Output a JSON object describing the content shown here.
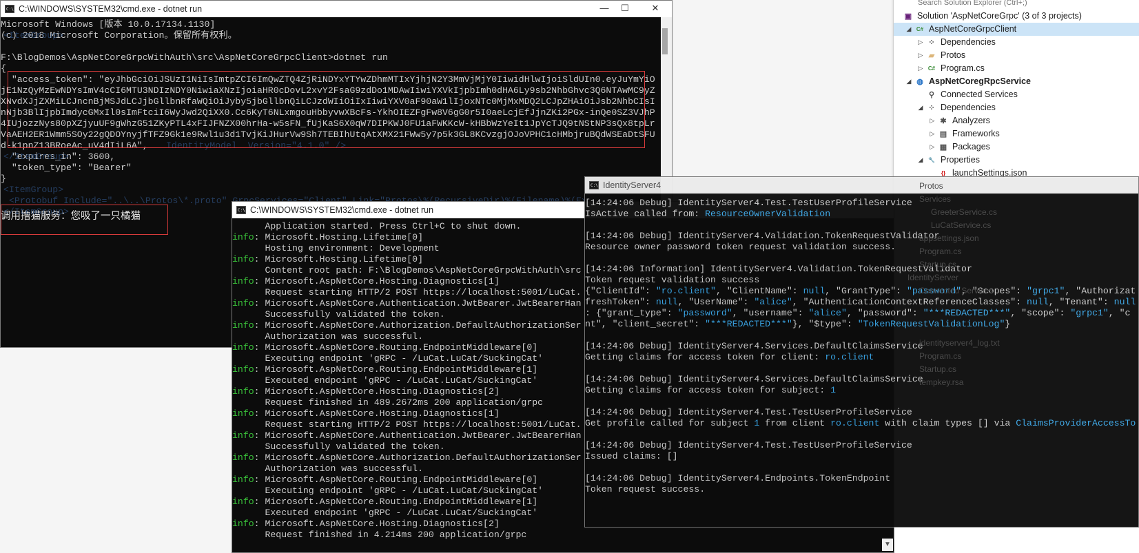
{
  "solution_explorer": {
    "search_placeholder": "Search Solution Explorer (Ctrl+;)",
    "rows": [
      {
        "label": "Solution 'AspNetCoreGrpc' (3 of 3 projects)",
        "icon": "solution-icon"
      },
      {
        "label": "AspNetCoreGrpcClient",
        "icon": "csharp-project-icon"
      },
      {
        "label": "Dependencies",
        "icon": "dependencies-icon"
      },
      {
        "label": "Protos",
        "icon": "folder-icon"
      },
      {
        "label": "Program.cs",
        "icon": "csharp-file-icon"
      },
      {
        "label": "AspNetCoregRpcService",
        "icon": "web-project-icon"
      },
      {
        "label": "Connected Services",
        "icon": "connected-services-icon"
      },
      {
        "label": "Dependencies",
        "icon": "dependencies-icon"
      },
      {
        "label": "Analyzers",
        "icon": "analyzers-icon"
      },
      {
        "label": "Frameworks",
        "icon": "frameworks-icon"
      },
      {
        "label": "Packages",
        "icon": "packages-icon"
      },
      {
        "label": "Properties",
        "icon": "wrench-icon"
      },
      {
        "label": "launchSettings.json",
        "icon": "json-file-icon"
      }
    ],
    "ghost_rows": [
      "Protos",
      "Services",
      "GreeterService.cs",
      "LuCatService.cs",
      "appsettings.json",
      "Program.cs",
      "Startup.cs",
      "IdentityServer",
      "Connected Services",
      "identityserver4_log.txt",
      "Program.cs",
      "Startup.cs",
      "tempkey.rsa"
    ]
  },
  "win1": {
    "title": "C:\\WINDOWS\\SYSTEM32\\cmd.exe - dotnet  run",
    "minimize": "—",
    "maximize": "☐",
    "close": "✕",
    "lines": [
      "Microsoft Windows [版本 10.0.17134.1130]",
      "(c) 2018 Microsoft Corporation。保留所有权利。",
      "",
      "F:\\BlogDemos\\AspNetCoreGrpcWithAuth\\src\\AspNetCoreGrpcClient>dotnet run",
      "{",
      "  \"access_token\": \"eyJhbGciOiJSUzI1NiIsImtpZCI6ImQwZTQ4ZjRiNDYxYTYwZDhmMTIxYjhjN2Y3MmVjMjY0IiwidHlwIjoiSldUIn0.eyJuYmYiO",
      "jE1NzQyMzEwNDYsImV4cCI6MTU3NDIzNDY0NiwiaXNzIjoiaHR0cDovL2xvY2FsaG9zdDo1MDAwIiwiYXVkIjpbImh0dHA6Ly9sb2NhbGhvc3Q6NTAwMC9yZ",
      "XNvdXJjZXMiLCJncnBjMSJdLCJjbGllbnRfaWQiOiJyby5jbGllbnQiLCJzdWIiOiIxIiwiYXV0aF90aW1lIjoxNTc0MjMxMDQ2LCJpZHAiOiJsb2NhbCIsI",
      "nNjb3BlIjpbImdycGMxIl0sImFtciI6WyJwd2QiXX0.Cc6KyT6NLxmgouHbbyvwXBcFs-YkhOIEZFgFw8V6gG0r5I0aeLcjEfJjnZKi2PGx-inQe0SZ3VJhP",
      "4IUjozzNys80pXZjyuUF9gWhzG51ZKyPTL4xFIJFNZX00hrHa-w5sFN_fUjKaS6X0qW7DIPKWJ0FU1aFWKKcW-kHBbWzYeIt1JpYcTJQ9tNStNP3sQx8tpLr",
      "VaAEH2ER1Wmm5SOy22gQDOYnyjfTFZ9Gk1e9Rwl1u3d1TvjKiJHurVw9Sh7TEBIhUtqAtXMX21FWw5y7p5k3GL8KCvzgjOJoVPHC1cHMbjruBQdWSEaDtSFU",
      "d-k1pnZ13BRoeAc_uV4dIiL6A\",",
      "  \"expires_in\": 3600,",
      "  \"token_type\": \"Bearer\"",
      "}",
      "",
      "",
      "调用撸猫服务：您吸了一只橘猫"
    ],
    "ghost_lines": [
      {
        "row": 1,
        "text": "<ItemGroup>"
      },
      {
        "row": 11,
        "text": "IdentityModel  Version=\"4.1.0\" />"
      },
      {
        "row": 12,
        "text": "</ItemGroup>"
      },
      {
        "row": 15,
        "text": "<ItemGroup>"
      },
      {
        "row": 16,
        "text": "<Protobuf Include=\"..\\..\\Protos\\*.proto\" GrpcServices=\"Client\" Link=\"Protos\\%(RecursiveDir)%(Filename)%(Extension)\" />"
      },
      {
        "row": 17,
        "text": "</ItemGroup>"
      }
    ]
  },
  "win2": {
    "title": "C:\\WINDOWS\\SYSTEM32\\cmd.exe - dotnet  run",
    "lines": [
      {
        "p": "",
        "t": "      Application started. Press Ctrl+C to shut down."
      },
      {
        "p": "info",
        "t": ": Microsoft.Hosting.Lifetime[0]"
      },
      {
        "p": "",
        "t": "      Hosting environment: Development"
      },
      {
        "p": "info",
        "t": ": Microsoft.Hosting.Lifetime[0]"
      },
      {
        "p": "",
        "t": "      Content root path: F:\\BlogDemos\\AspNetCoreGrpcWithAuth\\src"
      },
      {
        "p": "info",
        "t": ": Microsoft.AspNetCore.Hosting.Diagnostics[1]"
      },
      {
        "p": "",
        "t": "      Request starting HTTP/2 POST https://localhost:5001/LuCat."
      },
      {
        "p": "info",
        "t": ": Microsoft.AspNetCore.Authentication.JwtBearer.JwtBearerHan"
      },
      {
        "p": "",
        "t": "      Successfully validated the token."
      },
      {
        "p": "info",
        "t": ": Microsoft.AspNetCore.Authorization.DefaultAuthorizationSer"
      },
      {
        "p": "",
        "t": "      Authorization was successful."
      },
      {
        "p": "info",
        "t": ": Microsoft.AspNetCore.Routing.EndpointMiddleware[0]"
      },
      {
        "p": "",
        "t": "      Executing endpoint 'gRPC - /LuCat.LuCat/SuckingCat'"
      },
      {
        "p": "info",
        "t": ": Microsoft.AspNetCore.Routing.EndpointMiddleware[1]"
      },
      {
        "p": "",
        "t": "      Executed endpoint 'gRPC - /LuCat.LuCat/SuckingCat'"
      },
      {
        "p": "info",
        "t": ": Microsoft.AspNetCore.Hosting.Diagnostics[2]"
      },
      {
        "p": "",
        "t": "      Request finished in 489.2672ms 200 application/grpc"
      },
      {
        "p": "info",
        "t": ": Microsoft.AspNetCore.Hosting.Diagnostics[1]"
      },
      {
        "p": "",
        "t": "      Request starting HTTP/2 POST https://localhost:5001/LuCat."
      },
      {
        "p": "info",
        "t": ": Microsoft.AspNetCore.Authentication.JwtBearer.JwtBearerHan"
      },
      {
        "p": "",
        "t": "      Successfully validated the token."
      },
      {
        "p": "info",
        "t": ": Microsoft.AspNetCore.Authorization.DefaultAuthorizationSer"
      },
      {
        "p": "",
        "t": "      Authorization was successful."
      },
      {
        "p": "info",
        "t": ": Microsoft.AspNetCore.Routing.EndpointMiddleware[0]"
      },
      {
        "p": "",
        "t": "      Executing endpoint 'gRPC - /LuCat.LuCat/SuckingCat'"
      },
      {
        "p": "info",
        "t": ": Microsoft.AspNetCore.Routing.EndpointMiddleware[1]"
      },
      {
        "p": "",
        "t": "      Executed endpoint 'gRPC - /LuCat.LuCat/SuckingCat'"
      },
      {
        "p": "info",
        "t": ": Microsoft.AspNetCore.Hosting.Diagnostics[2]"
      },
      {
        "p": "",
        "t": "      Request finished in 4.214ms 200 application/grpc"
      }
    ]
  },
  "win3": {
    "title": "IdentityServer4",
    "lines": [
      [
        {
          "c": "w",
          "t": "[14:24:06 Debug] IdentityServer4.Test.TestUserProfileService"
        }
      ],
      [
        {
          "c": "w",
          "t": "IsActive called from: "
        },
        {
          "c": "c",
          "t": "ResourceOwnerValidation"
        }
      ],
      [],
      [
        {
          "c": "w",
          "t": "[14:24:06 Debug] IdentityServer4.Validation.TokenRequestValidator"
        }
      ],
      [
        {
          "c": "w",
          "t": "Resource owner password token request validation success."
        }
      ],
      [],
      [
        {
          "c": "w",
          "t": "[14:24:06 Information] IdentityServer4.Validation.TokenRequestValidator"
        }
      ],
      [
        {
          "c": "w",
          "t": "Token request validation success"
        }
      ],
      [
        {
          "c": "w",
          "t": "{\"ClientId\": "
        },
        {
          "c": "c",
          "t": "\"ro.client\""
        },
        {
          "c": "w",
          "t": ", \"ClientName\": "
        },
        {
          "c": "c",
          "t": "null"
        },
        {
          "c": "w",
          "t": ", \"GrantType\": "
        },
        {
          "c": "c",
          "t": "\"password\""
        },
        {
          "c": "w",
          "t": ", \"Scopes\": "
        },
        {
          "c": "c",
          "t": "\"grpc1\""
        },
        {
          "c": "w",
          "t": ", \"Authorizat"
        }
      ],
      [
        {
          "c": "w",
          "t": "freshToken\": "
        },
        {
          "c": "c",
          "t": "null"
        },
        {
          "c": "w",
          "t": ", \"UserName\": "
        },
        {
          "c": "c",
          "t": "\"alice\""
        },
        {
          "c": "w",
          "t": ", \"AuthenticationContextReferenceClasses\": "
        },
        {
          "c": "c",
          "t": "null"
        },
        {
          "c": "w",
          "t": ", \"Tenant\": "
        },
        {
          "c": "c",
          "t": "null"
        }
      ],
      [
        {
          "c": "w",
          "t": ": {\"grant_type\": "
        },
        {
          "c": "c",
          "t": "\"password\""
        },
        {
          "c": "w",
          "t": ", \"username\": "
        },
        {
          "c": "c",
          "t": "\"alice\""
        },
        {
          "c": "w",
          "t": ", \"password\": "
        },
        {
          "c": "c",
          "t": "\"***REDACTED***\""
        },
        {
          "c": "w",
          "t": ", \"scope\": "
        },
        {
          "c": "c",
          "t": "\"grpc1\""
        },
        {
          "c": "w",
          "t": ", \"c"
        }
      ],
      [
        {
          "c": "w",
          "t": "nt\", \"client_secret\": "
        },
        {
          "c": "c",
          "t": "\"***REDACTED***\""
        },
        {
          "c": "w",
          "t": "}, \"$type\": "
        },
        {
          "c": "c",
          "t": "\"TokenRequestValidationLog\""
        },
        {
          "c": "w",
          "t": "}"
        }
      ],
      [],
      [
        {
          "c": "w",
          "t": "[14:24:06 Debug] IdentityServer4.Services.DefaultClaimsService"
        }
      ],
      [
        {
          "c": "w",
          "t": "Getting claims for access token for client: "
        },
        {
          "c": "c",
          "t": "ro.client"
        }
      ],
      [],
      [
        {
          "c": "w",
          "t": "[14:24:06 Debug] IdentityServer4.Services.DefaultClaimsService"
        }
      ],
      [
        {
          "c": "w",
          "t": "Getting claims for access token for subject: "
        },
        {
          "c": "c",
          "t": "1"
        }
      ],
      [],
      [
        {
          "c": "w",
          "t": "[14:24:06 Debug] IdentityServer4.Test.TestUserProfileService"
        }
      ],
      [
        {
          "c": "w",
          "t": "Get profile called for subject "
        },
        {
          "c": "c",
          "t": "1"
        },
        {
          "c": "w",
          "t": " from client "
        },
        {
          "c": "c",
          "t": "ro.client"
        },
        {
          "c": "w",
          "t": " with claim types [] via "
        },
        {
          "c": "c",
          "t": "ClaimsProviderAccessTo"
        }
      ],
      [],
      [
        {
          "c": "w",
          "t": "[14:24:06 Debug] IdentityServer4.Test.TestUserProfileService"
        }
      ],
      [
        {
          "c": "w",
          "t": "Issued claims: []"
        }
      ],
      [],
      [
        {
          "c": "w",
          "t": "[14:24:06 Debug] IdentityServer4.Endpoints.TokenEndpoint"
        }
      ],
      [
        {
          "c": "w",
          "t": "Token request success."
        }
      ]
    ]
  },
  "colors": {
    "console_bg": "#0c0c0c",
    "console_text": "#cccccc",
    "info_green": "#3ac33a",
    "cyan": "#3aa7e8",
    "highlight_red": "#d63a3a"
  }
}
